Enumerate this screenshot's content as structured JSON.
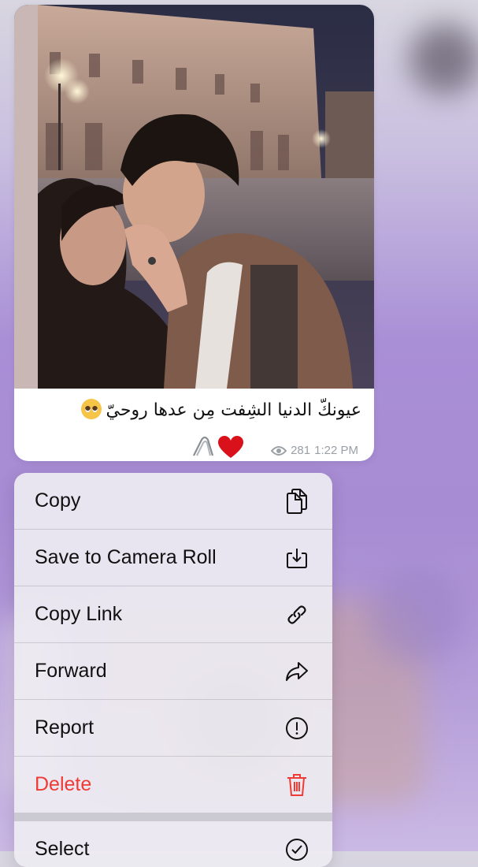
{
  "message": {
    "caption": "عيونكّ الدنيا الشِفت مِن عدها روحيّ",
    "views": "281",
    "time": "1:22 PM"
  },
  "context_menu": {
    "items": [
      {
        "label": "Copy",
        "icon": "copy-icon"
      },
      {
        "label": "Save to Camera Roll",
        "icon": "download-icon"
      },
      {
        "label": "Copy Link",
        "icon": "link-icon"
      },
      {
        "label": "Forward",
        "icon": "forward-icon"
      },
      {
        "label": "Report",
        "icon": "report-icon"
      },
      {
        "label": "Delete",
        "icon": "trash-icon",
        "color": "#ef3b35"
      },
      {
        "label": "Select",
        "icon": "check-circle-icon"
      }
    ]
  }
}
